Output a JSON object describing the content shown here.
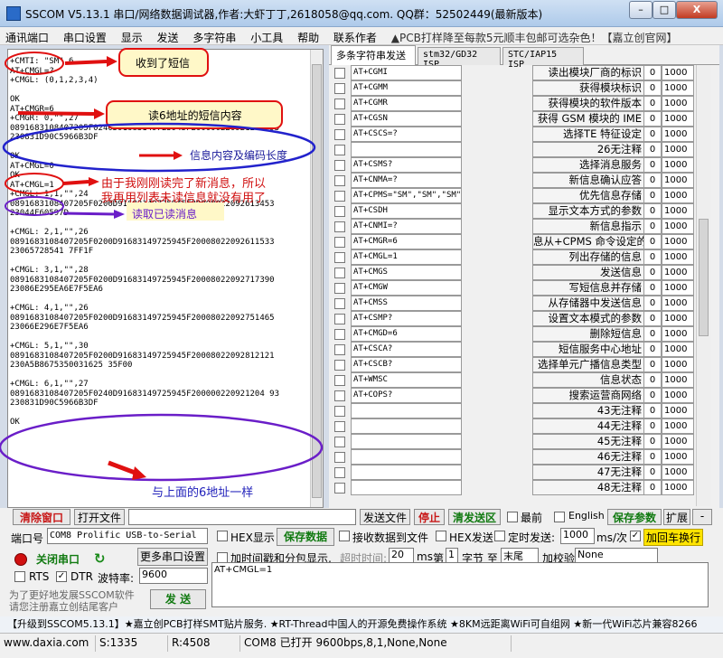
{
  "title": "SSCOM V5.13.1 串口/网络数据调试器,作者:大虾丁丁,2618058@qq.com. QQ群：52502449(最新版本)",
  "window_controls": {
    "min": "–",
    "max": "□",
    "close": "X"
  },
  "menu": [
    "通讯端口",
    "串口设置",
    "显示",
    "发送",
    "多字符串",
    "小工具",
    "帮助",
    "联系作者"
  ],
  "menu_ad": "▲PCB打样降至每款5元顺丰包邮可选杂色！【嘉立创官网】",
  "receive_text": "+CMTI: \"SM\",6\nAT+CMGL=?\n+CMGL: (0,1,2,3,4)\n\nOK\nAT+CMGR=6\n+CMGR: 0,\"\",27\n0891683108407205F0240D91683149725945F200000220921204 93\n230831D90C5966B3DF\n\nOK\nAT+CMGL=0\nOK\nAT+CMGL=1\n+CMGL: 1,1,\"\",24\n0891683108407205F0200D91683149725945F20008022092613453\n23044F60597D\n\n+CMGL: 2,1,\"\",26\n0891683108407205F0200D91683149725945F20008022092611533\n23065728541 7FF1F\n\n+CMGL: 3,1,\"\",28\n0891683108407205F0200D91683149725945F20008022092717390\n23086E295EA6E7F5EA6\n\n+CMGL: 4,1,\"\",26\n0891683108407205F0200D91683149725945F20008022092751465\n23066E296E7F5EA6\n\n+CMGL: 5,1,\"\",30\n0891683108407205F0200D91683149725945F20008022092812121\n230A5B8675350031625 35F00\n\n+CMGL: 6,1,\"\",27\n0891683108407205F0240D91683149725945F200000220921204 93\n230831D90C5966B3DF\n\nOK",
  "annotations": {
    "a1": "收到了短信",
    "a2": "读6地址的短信内容",
    "a3": "信息内容及编码长度",
    "a4a": "由于我刚刚读完了新消息，所以",
    "a4b": "我再用列表未读信息就没有用了",
    "a5": "读取已读消息",
    "a6": "与上面的6地址一样"
  },
  "tabs": [
    "多条字符串发送",
    "stm32/GD32 ISP",
    "STC/IAP15 ISP"
  ],
  "rows": [
    {
      "cmd": "AT+CGMI",
      "label": "读出模块厂商的标识",
      "num": "0",
      "delay": "1000"
    },
    {
      "cmd": "AT+CGMM",
      "label": "获得模块标识",
      "num": "0",
      "delay": "1000"
    },
    {
      "cmd": "AT+CGMR",
      "label": "获得模块的软件版本",
      "num": "0",
      "delay": "1000"
    },
    {
      "cmd": "AT+CGSN",
      "label": "获得 GSM 模块的 IME",
      "num": "0",
      "delay": "1000"
    },
    {
      "cmd": "AT+CSCS=?",
      "label": "选择TE 特征设定",
      "num": "0",
      "delay": "1000"
    },
    {
      "cmd": "",
      "label": "26无注释",
      "num": "0",
      "delay": "1000"
    },
    {
      "cmd": "AT+CSMS?",
      "label": "选择消息服务",
      "num": "0",
      "delay": "1000"
    },
    {
      "cmd": "AT+CNMA=?",
      "label": "新信息确认应答",
      "num": "0",
      "delay": "1000"
    },
    {
      "cmd": "AT+CPMS=\"SM\",\"SM\",\"SM\"",
      "label": "优先信息存储",
      "num": "0",
      "delay": "1000"
    },
    {
      "cmd": "AT+CSDH",
      "label": "显示文本方式的参数",
      "num": "0",
      "delay": "1000"
    },
    {
      "cmd": "AT+CNMI=?",
      "label": "新信息指示",
      "num": "0",
      "delay": "1000"
    },
    {
      "cmd": "AT+CMGR=6",
      "label": "息从+CPMS 命令设定的",
      "num": "0",
      "delay": "1000"
    },
    {
      "cmd": "AT+CMGL=1",
      "label": "列出存储的信息",
      "num": "0",
      "delay": "1000"
    },
    {
      "cmd": "AT+CMGS",
      "label": "发送信息",
      "num": "0",
      "delay": "1000"
    },
    {
      "cmd": "AT+CMGW",
      "label": "写短信息并存储",
      "num": "0",
      "delay": "1000"
    },
    {
      "cmd": "AT+CMSS",
      "label": "从存储器中发送信息",
      "num": "0",
      "delay": "1000"
    },
    {
      "cmd": "AT+CSMP?",
      "label": "设置文本模式的参数",
      "num": "0",
      "delay": "1000"
    },
    {
      "cmd": "AT+CMGD=6",
      "label": "删除短信息",
      "num": "0",
      "delay": "1000"
    },
    {
      "cmd": "AT+CSCA?",
      "label": "短信服务中心地址",
      "num": "0",
      "delay": "1000"
    },
    {
      "cmd": "AT+CSCB?",
      "label": "选择单元广播信息类型",
      "num": "0",
      "delay": "1000"
    },
    {
      "cmd": "AT+WMSC",
      "label": "信息状态",
      "num": "0",
      "delay": "1000"
    },
    {
      "cmd": "AT+COPS?",
      "label": "搜索运营商网络",
      "num": "0",
      "delay": "1000"
    },
    {
      "cmd": "",
      "label": "43无注释",
      "num": "0",
      "delay": "1000"
    },
    {
      "cmd": "",
      "label": "44无注释",
      "num": "0",
      "delay": "1000"
    },
    {
      "cmd": "",
      "label": "45无注释",
      "num": "0",
      "delay": "1000"
    },
    {
      "cmd": "",
      "label": "46无注释",
      "num": "0",
      "delay": "1000"
    },
    {
      "cmd": "",
      "label": "47无注释",
      "num": "0",
      "delay": "1000"
    },
    {
      "cmd": "",
      "label": "48无注释",
      "num": "0",
      "delay": "1000"
    }
  ],
  "controls": {
    "clear_window": "清除窗口",
    "open_file": "打开文件",
    "send_file": "发送文件",
    "stop": "停止",
    "clear_send": "清发送区",
    "topmost": "最前",
    "english": "English",
    "save_params": "保存参数",
    "expand": "扩展",
    "minus": "-",
    "port_label": "端口号",
    "port_value": "COM8 Prolific USB-to-Serial",
    "hex_show": "HEX显示",
    "save_data": "保存数据",
    "recv_to_file": "接收数据到文件",
    "hex_send": "HEX发送",
    "timed_send": "定时发送:",
    "timed_value": "1000",
    "per_time": "ms/次",
    "add_crlf": "加回车换行",
    "close_port": "关闭串口",
    "more_settings": "更多串口设置",
    "timestamp": "加时间戳和分包显示,",
    "timeout_label": "超时时间:",
    "timeout_value": "20",
    "ms": "ms",
    "di": "第",
    "byte_value": "1",
    "byte_label": "字节 至",
    "to_value": "末尾",
    "checksum_label": "加校验",
    "checksum_value": "None",
    "rts": "RTS",
    "dtr": "DTR",
    "baud_label": "波特率:",
    "baud_value": "9600",
    "send_text": "AT+CMGL=1",
    "promo1": "为了更好地发展SSCOM软件",
    "promo2": "请您注册嘉立创结尾客户",
    "send": "发 送"
  },
  "marquee": "【升级到SSCOM5.13.1】★嘉立创PCB打样SMT贴片服务. ★RT-Thread中国人的开源免费操作系统 ★8KM远距离WiFi可自组网 ★新一代WiFi芯片兼容8266",
  "status": {
    "url": "www.daxia.com",
    "s": "S:1335",
    "r": "R:4508",
    "port": "COM8 已打开  9600bps,8,1,None,None"
  }
}
